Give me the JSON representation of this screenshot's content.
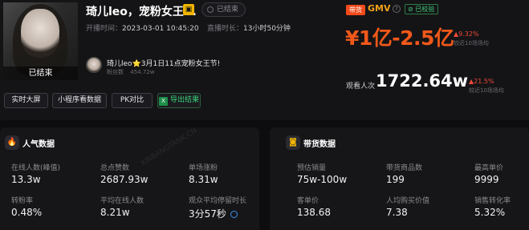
{
  "header": {
    "cover_status": "已结束",
    "title": "琦儿leo，宠粉女王...",
    "status_pill": "已结束",
    "open_time_label": "开播时间：",
    "open_time_value": "2023-03-01 10:45:20",
    "duration_label": "直播时长：",
    "duration_value": "13小时50分钟"
  },
  "gift": {
    "text": "琦儿leo⭐3月1日11点宠粉女王节!",
    "fans_label": "粉丝数",
    "fans_value": "454.72w"
  },
  "actions": {
    "realtime_screen": "实时大屏",
    "mini_program": "小程序看数据",
    "pk_compare": "PK对比",
    "export": "导出结果"
  },
  "gmv": {
    "tag": "带货",
    "label": "GMV",
    "info_icon": "?",
    "verified": "已校验",
    "value": "¥1亿-2.5亿",
    "delta": "9.32%",
    "delta_sub": "较近10场场均"
  },
  "viewers": {
    "label": "观看人次",
    "value": "1722.64w",
    "delta": "21.5%",
    "delta_sub": "较近10场场均"
  },
  "popularity": {
    "title": "人气数据",
    "icon": "flame-icon",
    "stats": [
      {
        "label": "在线人数(峰值)",
        "value": "13.3w"
      },
      {
        "label": "总点赞数",
        "value": "2687.93w"
      },
      {
        "label": "单场涨粉",
        "value": "8.31w"
      },
      {
        "label": "转粉率",
        "value": "0.48%"
      },
      {
        "label": "平均在线人数",
        "value": "8.21w"
      },
      {
        "label": "观众平均停留时长",
        "value": "3分57秒"
      }
    ]
  },
  "sales": {
    "title": "带货数据",
    "icon": "bag-icon",
    "stats": [
      {
        "label": "预估销量",
        "value": "75w-100w"
      },
      {
        "label": "带货商品数",
        "value": "199"
      },
      {
        "label": "最高单价",
        "value": "9999"
      },
      {
        "label": "客单价",
        "value": "138.68"
      },
      {
        "label": "人均购买价值",
        "value": "7.38"
      },
      {
        "label": "销售转化率",
        "value": "5.32%"
      }
    ]
  },
  "colors": {
    "accent_orange": "#f2581a",
    "gmv_gold": "#f2a21a",
    "up_red": "#f24a3a",
    "verified_green": "#3fcf78"
  }
}
